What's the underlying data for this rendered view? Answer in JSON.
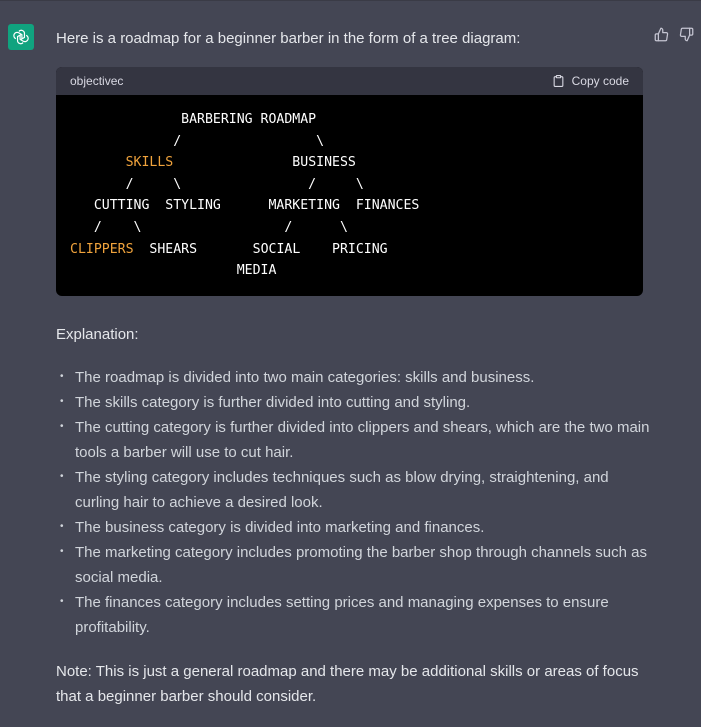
{
  "assistant": {
    "avatar_icon": "openai-logo-icon",
    "avatar_color": "#10a37f"
  },
  "feedback": {
    "thumbs_up_icon": "thumbs-up-icon",
    "thumbs_down_icon": "thumbs-down-icon"
  },
  "message": {
    "intro": "Here is a roadmap for a beginner barber in the form of a tree diagram:",
    "code": {
      "language": "objectivec",
      "copy_label": "Copy code",
      "highlight_color": "#f0a33c",
      "lines": [
        [
          {
            "t": "              BARBERING ROADMAP"
          }
        ],
        [
          {
            "t": "             /                 \\"
          }
        ],
        [
          {
            "t": "       "
          },
          {
            "t": "SKILLS",
            "hl": true
          },
          {
            "t": "               BUSINESS"
          }
        ],
        [
          {
            "t": "       /     \\                /     \\"
          }
        ],
        [
          {
            "t": "   CUTTING  STYLING      MARKETING  FINANCES"
          }
        ],
        [
          {
            "t": "   /    \\                  /      \\"
          }
        ],
        [
          {
            "t": ""
          },
          {
            "t": "CLIPPERS",
            "hl": true
          },
          {
            "t": "  SHEARS       SOCIAL    PRICING"
          }
        ],
        [
          {
            "t": "                     MEDIA"
          }
        ]
      ]
    },
    "explanation_heading": "Explanation:",
    "bullets": [
      "The roadmap is divided into two main categories: skills and business.",
      "The skills category is further divided into cutting and styling.",
      "The cutting category is further divided into clippers and shears, which are the two main tools a barber will use to cut hair.",
      "The styling category includes techniques such as blow drying, straightening, and curling hair to achieve a desired look.",
      "The business category is divided into marketing and finances.",
      "The marketing category includes promoting the barber shop through channels such as social media.",
      "The finances category includes setting prices and managing expenses to ensure profitability."
    ],
    "note": "Note: This is just a general roadmap and there may be additional skills or areas of focus that a beginner barber should consider."
  }
}
